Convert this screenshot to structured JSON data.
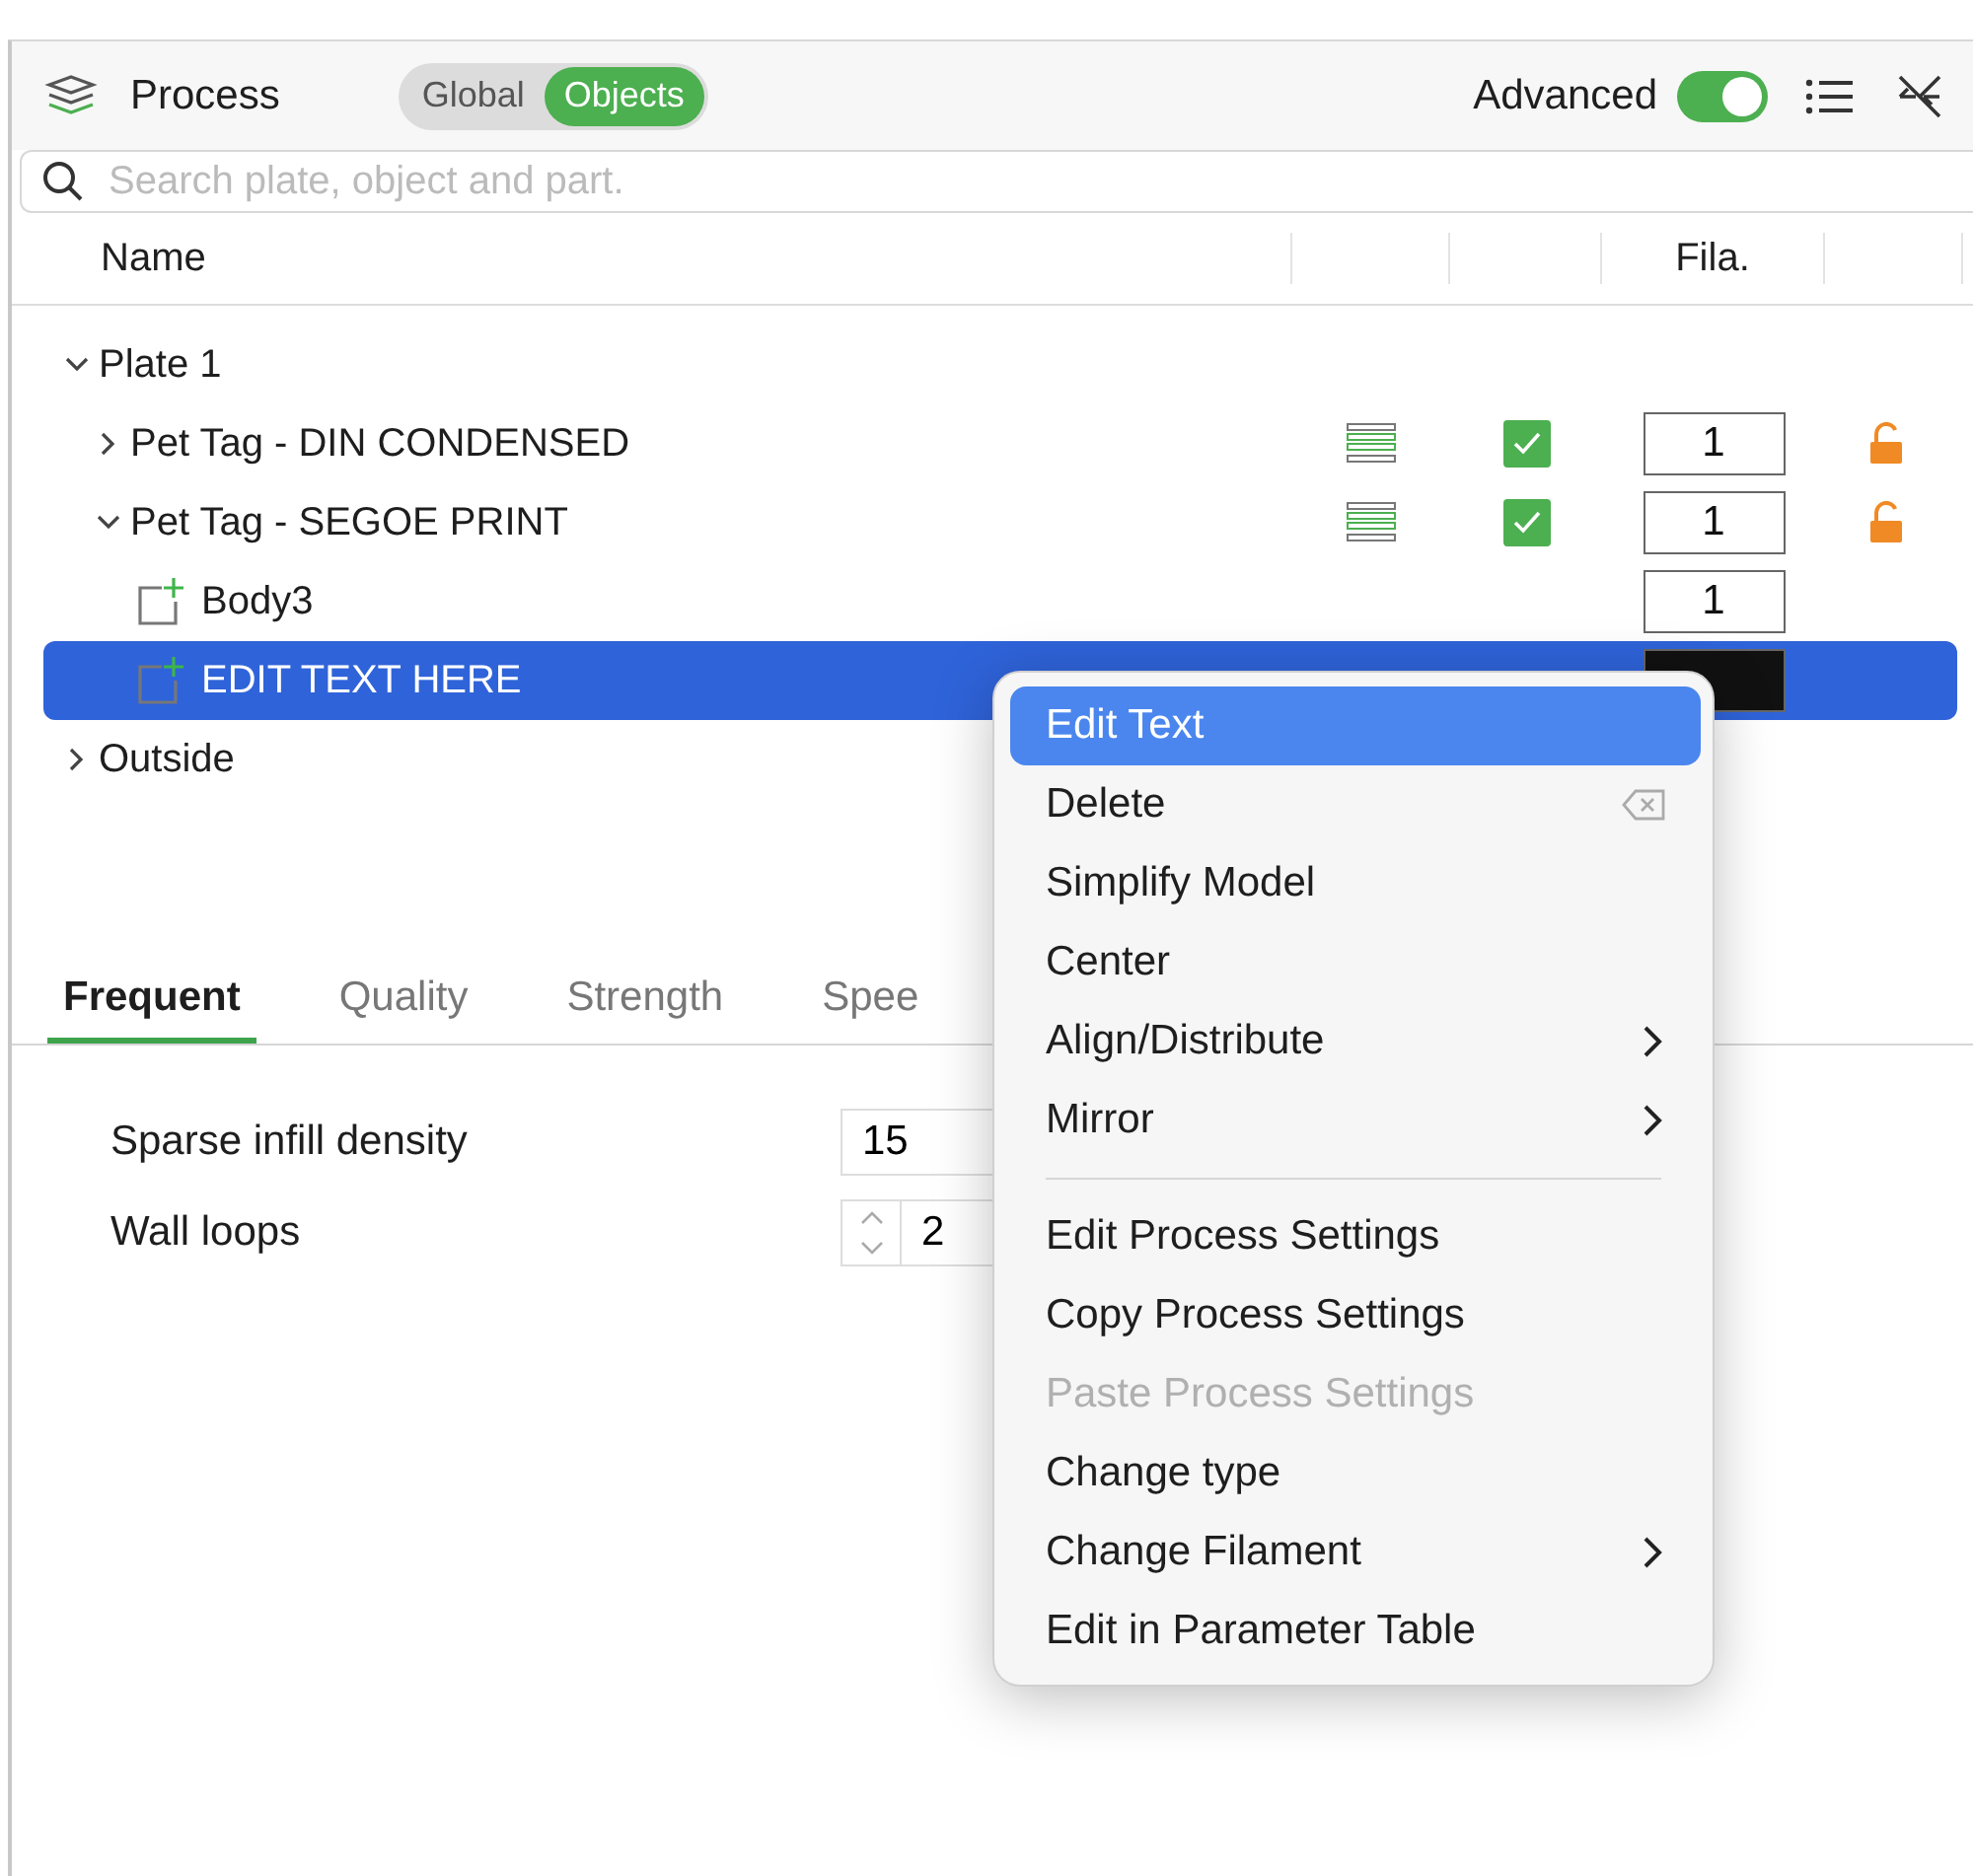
{
  "header": {
    "title": "Process",
    "segments": [
      {
        "label": "Global",
        "selected": false
      },
      {
        "label": "Objects",
        "selected": true
      }
    ],
    "advanced_label": "Advanced",
    "advanced_on": true
  },
  "search": {
    "placeholder": "Search plate, object and part."
  },
  "table": {
    "columns": [
      "Name",
      "",
      "",
      "Fila.",
      ""
    ],
    "rows": [
      {
        "name": "Plate 1",
        "expanded": true,
        "children": [
          {
            "name": "Pet Tag - DIN CONDENSED",
            "expanded": false,
            "stack_icon": true,
            "checked": true,
            "filament": "1",
            "locked": false,
            "selected": false
          },
          {
            "name": "Pet Tag - SEGOE PRINT",
            "expanded": true,
            "stack_icon": true,
            "checked": true,
            "filament": "1",
            "locked": false,
            "selected": false,
            "children": [
              {
                "name": "Body3",
                "kind": "part",
                "filament": "1",
                "selected": false
              },
              {
                "name": "EDIT TEXT HERE",
                "kind": "part",
                "selected": true
              }
            ]
          }
        ]
      },
      {
        "name": "Outside",
        "expanded": false
      }
    ]
  },
  "tabs": [
    {
      "label": "Frequent",
      "selected": true
    },
    {
      "label": "Quality",
      "selected": false
    },
    {
      "label": "Strength",
      "selected": false
    },
    {
      "label": "Spee",
      "selected": false
    }
  ],
  "settings": [
    {
      "label": "Sparse infill density",
      "value": "15",
      "kind": "text"
    },
    {
      "label": "Wall loops",
      "value": "2",
      "kind": "spin"
    }
  ],
  "context_menu": [
    {
      "kind": "item",
      "label": "Edit Text",
      "selected": true,
      "disabled": false
    },
    {
      "kind": "item",
      "label": "Delete",
      "selected": false,
      "disabled": false,
      "shortcut_icon": true
    },
    {
      "kind": "item",
      "label": "Simplify Model",
      "selected": false,
      "disabled": false
    },
    {
      "kind": "item",
      "label": "Center",
      "selected": false,
      "disabled": false
    },
    {
      "kind": "item",
      "label": "Align/Distribute",
      "selected": false,
      "disabled": false,
      "submenu": true
    },
    {
      "kind": "item",
      "label": "Mirror",
      "selected": false,
      "disabled": false,
      "submenu": true
    },
    {
      "kind": "separator"
    },
    {
      "kind": "item",
      "label": "Edit Process Settings",
      "selected": false,
      "disabled": false
    },
    {
      "kind": "item",
      "label": "Copy Process Settings",
      "selected": false,
      "disabled": false
    },
    {
      "kind": "item",
      "label": "Paste Process Settings",
      "selected": false,
      "disabled": true
    },
    {
      "kind": "item",
      "label": "Change type",
      "selected": false,
      "disabled": false
    },
    {
      "kind": "item",
      "label": "Change Filament",
      "selected": false,
      "disabled": false,
      "submenu": true
    },
    {
      "kind": "item",
      "label": "Edit in Parameter Table",
      "selected": false,
      "disabled": false
    }
  ]
}
